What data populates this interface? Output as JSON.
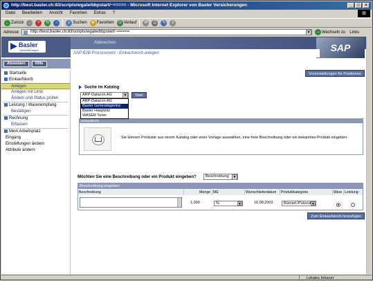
{
  "window": {
    "title": "http://best.basler.ch:83/scripts/wgate/bbpstart/~====="
  },
  "titlebar": {
    "suffix": " - Microsoft Internet Explorer von Basler Versicherungen",
    "min": "_",
    "max": "□",
    "close": "×"
  },
  "menu": [
    "Datei",
    "Bearbeiten",
    "Ansicht",
    "Favoriten",
    "Extras",
    "?"
  ],
  "toolbar": {
    "back": "Zurück",
    "forward": "",
    "search": "Suchen",
    "favorites": "Favoriten",
    "history": "Verlauf"
  },
  "address": {
    "label": "Adresse",
    "url": "http://best.basler.ch:83/scripts/wgate/bbpstart/~=====",
    "go": "Wechseln zu",
    "links": "Links"
  },
  "header": {
    "logo": "Basler",
    "logo_sub": "Versicherungen",
    "abbrechen": "Abbrechen",
    "sap": "SAP",
    "breadcrumb": "SAP B2B Procurement - Einkaufskorb anlegen"
  },
  "nav": {
    "abmelden": "Abmelden",
    "hilfe": "Hilfe"
  },
  "sidebar": [
    {
      "label": "Startseite",
      "level": 0,
      "selected": false
    },
    {
      "label": "Einkaufskorb",
      "level": 0,
      "selected": false
    },
    {
      "label": "Anlegen",
      "level": 1,
      "selected": true
    },
    {
      "label": "Anlegen mit Limit",
      "level": 1,
      "selected": false
    },
    {
      "label": "Ändern und Status prüfen",
      "level": 1,
      "selected": false
    },
    {
      "label": "Leistung / Warenempfang",
      "level": 0,
      "selected": false
    },
    {
      "label": "Bestätigen",
      "level": 1,
      "selected": false
    },
    {
      "label": "Rechnung",
      "level": 0,
      "selected": false
    },
    {
      "label": "Erfassen",
      "level": 1,
      "selected": false
    },
    {
      "label": "Mein Arbeitsplatz",
      "level": 0,
      "selected": false
    },
    {
      "label": "Eingang",
      "level": 1,
      "selected": false
    },
    {
      "label": "Einstellungen ändern",
      "level": 1,
      "selected": false
    },
    {
      "label": "Attribute ändern",
      "level": 1,
      "selected": false
    }
  ],
  "main": {
    "voreinstellungen": "Voreinstellungen für Positionen",
    "suche_label": "Suche im Katalog",
    "catalog_selected": "ARP-Datacon AG",
    "start": "Start",
    "catalog_options": [
      "ARP-Datacon AG",
      "Basler Generalagentur",
      "Basler Hauptsitz",
      "WASER Toner"
    ],
    "catalog_highlighted": 1,
    "info_header": "Einkaufskorb",
    "info_text": "Sie können Produkte aus einem Katalog oder einer Vorlage auswählen, eine freie Beschreibung oder ein bekanntes Produkt eingeben.",
    "question": "Möchten Sie eine Beschreibung oder ein Produkt eingeben?",
    "question_sel": "Beschreibung",
    "table_header": "Beschreibung eingeben",
    "cols": [
      "Beschreibung",
      "Menge",
      "ME",
      "Wunschlieferdatum",
      "Produktkategorie",
      "Ware",
      "Leistung"
    ],
    "row": {
      "menge": "1,000",
      "me": "%",
      "datum": "16.08.2002",
      "kategorie": "Büro­art./Putzzub.",
      "ware": true
    },
    "add": "Zum Einkaufskorb hinzufügen"
  },
  "status": {
    "zone": "Lokales Intranet"
  }
}
